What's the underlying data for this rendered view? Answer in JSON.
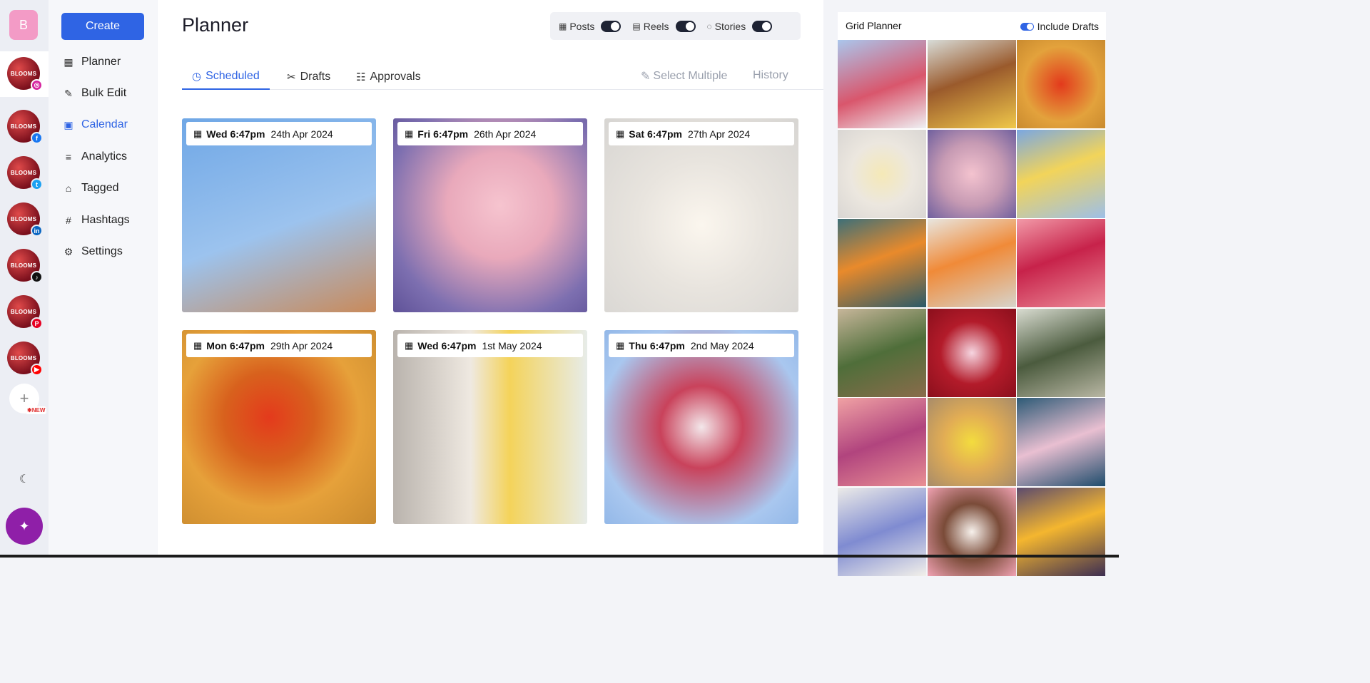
{
  "rail": {
    "brand_initial": "B",
    "accounts": [
      {
        "name": "BLOOMS",
        "network": "instagram",
        "badge": "◎",
        "color": "#d6249f",
        "active": true
      },
      {
        "name": "BLOOMS",
        "network": "facebook",
        "badge": "f",
        "color": "#1877f2"
      },
      {
        "name": "BLOOMS",
        "network": "twitter",
        "badge": "t",
        "color": "#1da1f2"
      },
      {
        "name": "BLOOMS",
        "network": "linkedin",
        "badge": "in",
        "color": "#0a66c2"
      },
      {
        "name": "BLOOMS",
        "network": "tiktok",
        "badge": "♪",
        "color": "#111111"
      },
      {
        "name": "BLOOMS",
        "network": "pinterest",
        "badge": "P",
        "color": "#e60023"
      },
      {
        "name": "BLOOMS",
        "network": "youtube",
        "badge": "▶",
        "color": "#ff0000"
      }
    ],
    "add_icon": "+",
    "new_label": "✱NEW",
    "theme_icon": "☾",
    "ai_icon": "✦"
  },
  "nav": {
    "create_label": "Create",
    "items": [
      {
        "label": "Planner",
        "icon": "grid-icon",
        "glyph": "▦",
        "active": false
      },
      {
        "label": "Bulk Edit",
        "icon": "edit-icon",
        "glyph": "✎",
        "active": false
      },
      {
        "label": "Calendar",
        "icon": "calendar-icon",
        "glyph": "▣",
        "active": true
      },
      {
        "label": "Analytics",
        "icon": "analytics-icon",
        "glyph": "≡",
        "active": false
      },
      {
        "label": "Tagged",
        "icon": "tag-icon",
        "glyph": "⌂",
        "active": false
      },
      {
        "label": "Hashtags",
        "icon": "hashtag-icon",
        "glyph": "#",
        "active": false
      },
      {
        "label": "Settings",
        "icon": "gear-icon",
        "glyph": "⚙",
        "active": false
      }
    ]
  },
  "header": {
    "title": "Planner",
    "toggles": [
      {
        "label": "Posts",
        "icon": "grid-icon",
        "glyph": "▦",
        "on": true
      },
      {
        "label": "Reels",
        "icon": "reels-icon",
        "glyph": "▤",
        "on": true
      },
      {
        "label": "Stories",
        "icon": "stories-icon",
        "glyph": "◌",
        "on": true
      }
    ]
  },
  "tabs": [
    {
      "label": "Scheduled",
      "icon": "clock-icon",
      "glyph": "◷",
      "active": true
    },
    {
      "label": "Drafts",
      "icon": "drafts-icon",
      "glyph": "✂",
      "active": false
    },
    {
      "label": "Approvals",
      "icon": "approvals-icon",
      "glyph": "☷",
      "active": false
    }
  ],
  "actions": {
    "select_multiple": "Select Multiple",
    "select_icon": "✎",
    "history": "History"
  },
  "posts": [
    {
      "day": "Wed 6:47pm",
      "date": "24th Apr 2024",
      "bg": "linear-gradient(160deg,#6fa7e6 0%,#9cc3ee 55%,#c98a5a 100%)"
    },
    {
      "day": "Fri 6:47pm",
      "date": "26th Apr 2024",
      "bg": "radial-gradient(circle at 55% 45%,#f6c4cf 0%,#e9a9bb 35%,#7d6fb0 75%,#5f5298 100%)"
    },
    {
      "day": "Sat 6:47pm",
      "date": "27th Apr 2024",
      "bg": "radial-gradient(circle at 50% 55%,#fbf6ee 0%,#e8e4de 45%,#d7d5d2 100%)"
    },
    {
      "day": "Mon 6:47pm",
      "date": "29th Apr 2024",
      "bg": "radial-gradient(circle at 45% 45%,#e43a1c 0%,#d8611d 30%,#e6a13a 60%,#c98a2e 100%)"
    },
    {
      "day": "Wed 6:47pm",
      "date": "1st May 2024",
      "bg": "linear-gradient(90deg,#b9b3ad 0%,#efe9e1 40%,#f4d35a 60%,#e7ece9 100%)"
    },
    {
      "day": "Thu 6:47pm",
      "date": "2nd May 2024",
      "bg": "radial-gradient(circle at 50% 50%,#f3e7ea 0%,#c9425b 30%,#a9c7ef 75%,#93b8e8 100%)"
    }
  ],
  "grid_planner": {
    "title": "Grid Planner",
    "include_drafts_label": "Include Drafts",
    "cells": [
      "linear-gradient(160deg,#aac6ec,#d9566c 55%,#eff1f4)",
      "linear-gradient(160deg,#d8dcd8,#9a5a2c 45%,#f0c84a)",
      "radial-gradient(circle at 50% 50%,#e33a1c,#e3a23c 60%,#c98a2e)",
      "radial-gradient(circle at 50% 50%,#f5e9b7,#ece7df 50%,#d9d6d3)",
      "radial-gradient(circle at 50% 50%,#f4c3cf,#c69ab3 50%,#6f5f9e)",
      "linear-gradient(160deg,#7aa7e2,#f2d45a 45%,#9dbfe8)",
      "linear-gradient(160deg,#3d6f78,#e98a2b 45%,#2a5a68)",
      "linear-gradient(160deg,#e8e6e0,#f08a38 45%,#d7d4cc)",
      "linear-gradient(160deg,#f29aa8,#c7224a 45%,#ec8b98)",
      "linear-gradient(160deg,#c7b69a,#4f6e3a 50%,#8a6c4b)",
      "radial-gradient(circle at 50% 50%,#f6d5e0,#b31b2a 50%,#8a0f1c)",
      "linear-gradient(160deg,#d9dcd1,#4b5b3e 50%,#b9b7a4)",
      "linear-gradient(160deg,#f0a2a4,#b1447e 50%,#e98f94)",
      "radial-gradient(circle at 50% 50%,#f3dc3e,#e2ad54 45%,#a78b6a)",
      "linear-gradient(160deg,#2c5a76,#e9bfd1 50%,#1e4c6c)",
      "linear-gradient(160deg,#ecebe8,#7f8bd1 50%,#f2f0ea)",
      "radial-gradient(circle at 50% 50%,#f7f1ec,#7a4b38 45%,#f0a2b3)",
      "linear-gradient(160deg,#5b4a6e,#f4b62f 45%,#3d2e52)"
    ]
  }
}
